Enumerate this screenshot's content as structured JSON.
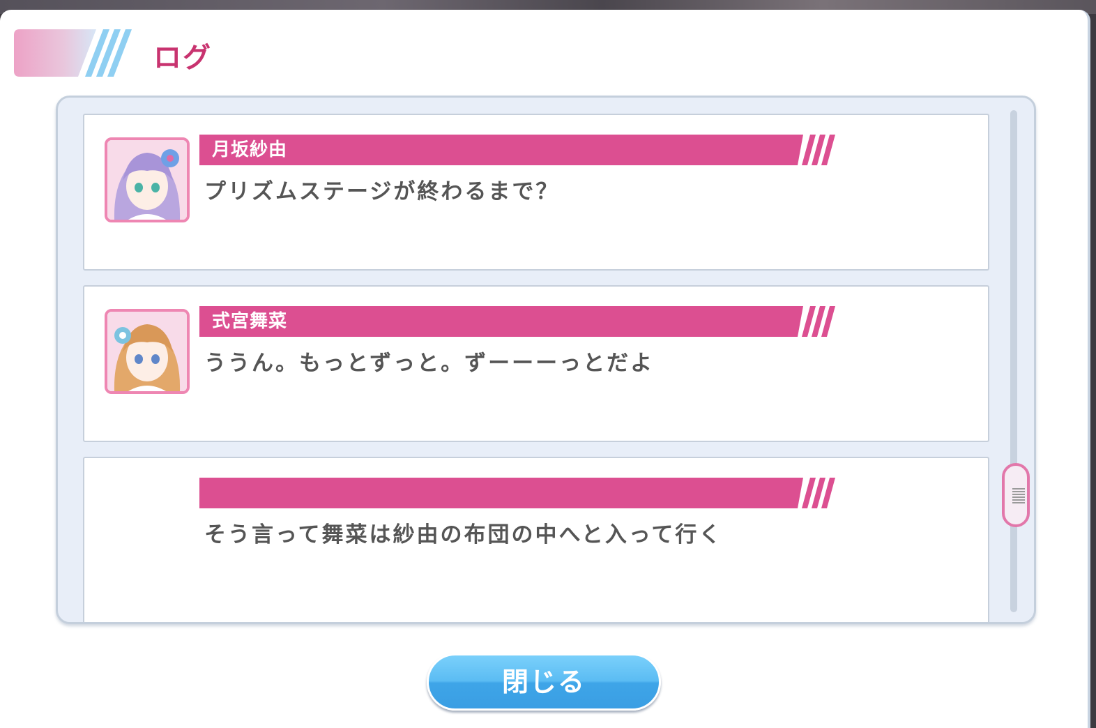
{
  "header": {
    "title": "ログ"
  },
  "log": {
    "entries": [
      {
        "speaker": "月坂紗由",
        "text": "プリズムステージが終わるまで？",
        "avatar": "sayu-portrait"
      },
      {
        "speaker": "式宮舞菜",
        "text": "ううん。もっとずっと。ずーーーっとだよ",
        "avatar": "mana-portrait"
      },
      {
        "speaker": "",
        "text": "そう言って舞菜は紗由の布団の中へと入って行く",
        "avatar": ""
      }
    ]
  },
  "footer": {
    "close_label": "閉じる"
  },
  "colors": {
    "accent_pink": "#dc4f91",
    "title_pink": "#c8336f",
    "button_blue": "#4aaeea"
  }
}
